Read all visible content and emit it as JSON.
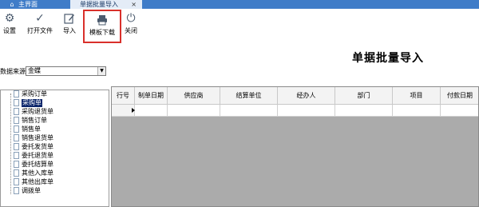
{
  "tabs": {
    "home_label": "主界面",
    "import_label": "单据批量导入",
    "close_glyph": "×"
  },
  "toolbar": {
    "settings_label": "设置",
    "open_file_label": "打开文件",
    "import_label": "导入",
    "template_download_label": "模板下载",
    "close_label": "关闭",
    "icons": {
      "settings": "gear-icon",
      "open_file": "check-icon",
      "import": "edit-icon",
      "template_download": "printer-icon",
      "close": "power-icon"
    },
    "highlight_color": "#d9302b"
  },
  "page": {
    "title": "单据批量导入"
  },
  "source": {
    "label": "数据来源",
    "selected": "金蝶"
  },
  "tree": {
    "items": [
      "采购订单",
      "采购单",
      "采购退货单",
      "销售订单",
      "销售单",
      "销售退货单",
      "委托发货单",
      "委托退货单",
      "委托结算单",
      "其他入库单",
      "其他出库单",
      "调拨单"
    ],
    "selected_index": 1
  },
  "grid": {
    "columns": [
      "行号",
      "制单日期",
      "供应商",
      "结算单位",
      "经办人",
      "部门",
      "项目",
      "付款日期"
    ]
  },
  "colors": {
    "tab_bar": "#3f7cc8",
    "active_tab": "#e4ecf7",
    "selection": "#0a246a",
    "grid_background": "#ababab"
  }
}
